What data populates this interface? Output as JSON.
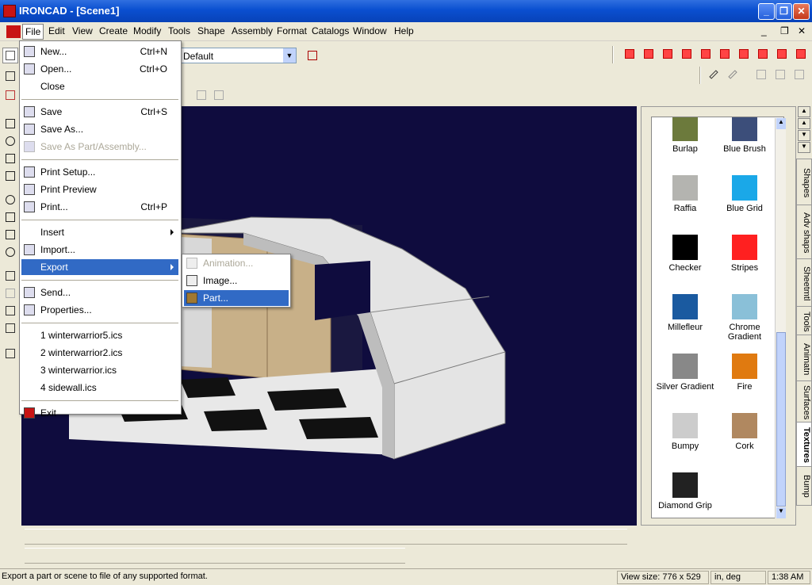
{
  "window": {
    "title": "IRONCAD - [Scene1]",
    "minimize": "_",
    "restore": "❐",
    "close": "✕"
  },
  "menubar": {
    "items": [
      "File",
      "Edit",
      "View",
      "Create",
      "Modify",
      "Tools",
      "Shape",
      "Assembly",
      "Format",
      "Catalogs",
      "Window",
      "Help"
    ],
    "doc_minimize": "_",
    "doc_restore": "❐",
    "doc_close": "✕"
  },
  "toolbar": {
    "style_combo_value": "Default"
  },
  "file_menu": {
    "items": [
      {
        "label": "New...",
        "shortcut": "Ctrl+N",
        "icon": "new-file-icon",
        "disabled": false
      },
      {
        "label": "Open...",
        "shortcut": "Ctrl+O",
        "icon": "open-folder-icon",
        "disabled": false
      },
      {
        "label": "Close",
        "shortcut": "",
        "icon": "",
        "disabled": false
      },
      {
        "sep": true
      },
      {
        "label": "Save",
        "shortcut": "Ctrl+S",
        "icon": "save-disk-icon",
        "disabled": false
      },
      {
        "label": "Save As...",
        "shortcut": "",
        "icon": "save-as-icon",
        "disabled": false
      },
      {
        "label": "Save As Part/Assembly...",
        "shortcut": "",
        "icon": "save-part-icon",
        "disabled": true
      },
      {
        "sep": true
      },
      {
        "label": "Print Setup...",
        "shortcut": "",
        "icon": "print-setup-icon",
        "disabled": false
      },
      {
        "label": "Print Preview",
        "shortcut": "",
        "icon": "print-preview-icon",
        "disabled": false
      },
      {
        "label": "Print...",
        "shortcut": "Ctrl+P",
        "icon": "printer-icon",
        "disabled": false
      },
      {
        "sep": true
      },
      {
        "label": "Insert",
        "shortcut": "",
        "icon": "",
        "disabled": false,
        "submenu": true
      },
      {
        "label": "Import...",
        "shortcut": "",
        "icon": "import-icon",
        "disabled": false
      },
      {
        "label": "Export",
        "shortcut": "",
        "icon": "",
        "disabled": false,
        "submenu": true,
        "selected": true
      },
      {
        "sep": true
      },
      {
        "label": "Send...",
        "shortcut": "",
        "icon": "send-icon",
        "disabled": false
      },
      {
        "label": "Properties...",
        "shortcut": "",
        "icon": "properties-icon",
        "disabled": false
      },
      {
        "sep": true
      },
      {
        "label": "1 winterwarrior5.ics",
        "shortcut": "",
        "icon": "",
        "disabled": false
      },
      {
        "label": "2 winterwarrior2.ics",
        "shortcut": "",
        "icon": "",
        "disabled": false
      },
      {
        "label": "3 winterwarrior.ics",
        "shortcut": "",
        "icon": "",
        "disabled": false
      },
      {
        "label": "4 sidewall.ics",
        "shortcut": "",
        "icon": "",
        "disabled": false
      },
      {
        "sep": true
      },
      {
        "label": "Exit",
        "shortcut": "",
        "icon": "exit-icon",
        "disabled": false
      }
    ]
  },
  "export_submenu": {
    "items": [
      {
        "label": "Animation...",
        "disabled": true,
        "icon": "animation-icon"
      },
      {
        "label": "Image...",
        "disabled": false,
        "icon": "image-icon"
      },
      {
        "label": "Part...",
        "disabled": false,
        "icon": "part-icon",
        "selected": true
      }
    ]
  },
  "catalog": {
    "textures": [
      {
        "name": "Burlap",
        "color": "#6c7a3c"
      },
      {
        "name": "Blue Brush",
        "color": "#3c4e7a"
      },
      {
        "name": "Raffia",
        "color": "#b4b4b0"
      },
      {
        "name": "Blue Grid",
        "color": "#1aa8e8"
      },
      {
        "name": "Checker",
        "color": "#000000"
      },
      {
        "name": "Stripes",
        "color": "#ff2020"
      },
      {
        "name": "Millefleur",
        "color": "#1a5aa0"
      },
      {
        "name": "Chrome Gradient",
        "color": "#8ac0d8"
      },
      {
        "name": "Silver Gradient",
        "color": "#888888"
      },
      {
        "name": "Fire",
        "color": "#e07a10"
      },
      {
        "name": "Bumpy",
        "color": "#cccccc"
      },
      {
        "name": "Cork",
        "color": "#b08860"
      },
      {
        "name": "Diamond Grip",
        "color": "#222222"
      }
    ],
    "tabs": [
      "Shapes",
      "Adv shaps",
      "Sheetmtl",
      "Tools",
      "Animatn",
      "Surfaces",
      "Textures",
      "Bump"
    ],
    "active_tab": "Textures"
  },
  "statusbar": {
    "message": "Export a part or scene to file of any supported format.",
    "view_size": "View size:  776 x  529",
    "units": "in, deg",
    "time": "1:38 AM"
  }
}
